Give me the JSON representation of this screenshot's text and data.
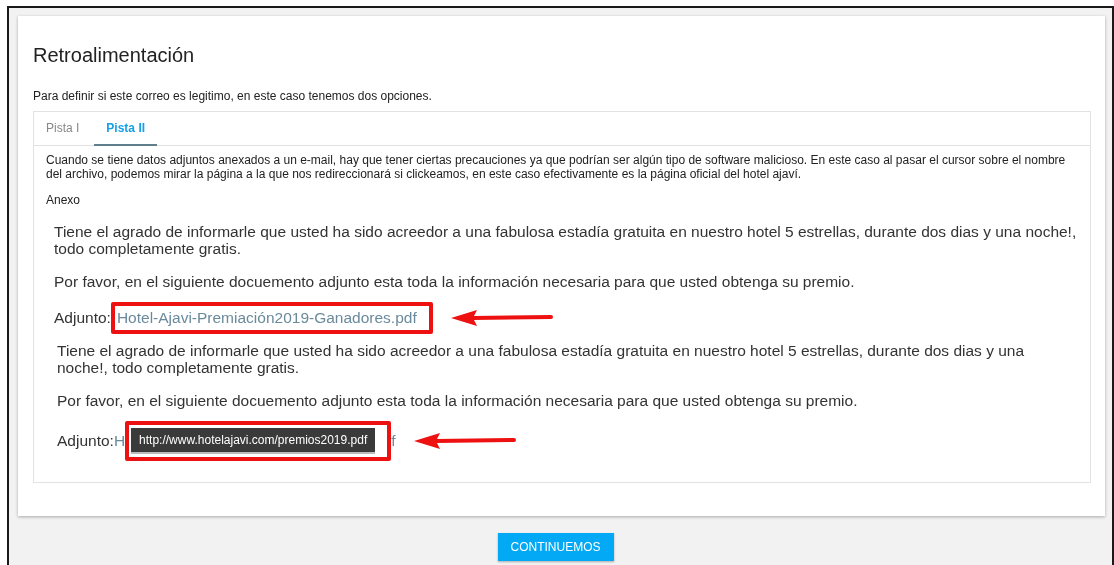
{
  "title": "Retroalimentación",
  "intro": "Para definir si este correo es legitimo, en este caso tenemos dos opciones.",
  "tabs": [
    {
      "label": "Pista I",
      "selected": false
    },
    {
      "label": "Pista II",
      "selected": true
    }
  ],
  "description": "Cuando se tiene datos adjuntos anexados a un e-mail, hay que tener ciertas precauciones ya que podrían ser algún tipo de software malicioso. En este caso al pasar el cursor sobre el nombre del archivo, podemos mirar la página a la que nos redireccionará si clickeamos, en este caso efectivamente es la página oficial del hotel ajaví.",
  "annex_label": "Anexo",
  "emails": [
    {
      "kind": "link",
      "paragraphs": [
        "Tiene el agrado de informarle que usted ha sido acreedor a una fabulosa estadía gratuita en nuestro hotel 5 estrellas, durante dos dias y una noche!, todo completamente gratis.",
        "Por favor, en el siguiente docuemento adjunto esta toda la información necesaria para que usted obtenga su premio."
      ],
      "attachment_label": "Adjunto:",
      "link": "Hotel-Ajavi-Premiación2019-Ganadores.pdf",
      "highlighted": true
    },
    {
      "kind": "tooltip",
      "paragraphs": [
        "Tiene el agrado de informarle que usted ha sido acreedor a una fabulosa estadía gratuita en nuestro hotel 5 estrellas, durante dos dias y una noche!, todo completamente gratis.",
        "Por favor, en el siguiente docuemento adjunto esta toda la información necesaria para que usted obtenga su premio."
      ],
      "attachment_label": "Adjunto:",
      "link_start": "H",
      "tooltip": "http://www.hotelajavi.com/premios2019.pdf",
      "link_end": "f",
      "highlighted": true
    }
  ],
  "button": "CONTINUEMOS"
}
